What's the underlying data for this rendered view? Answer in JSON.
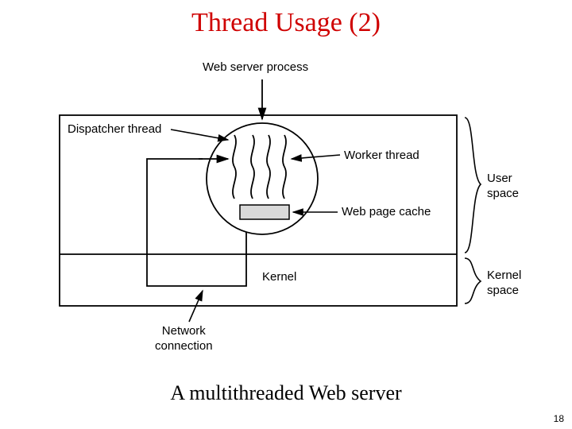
{
  "title": "Thread Usage (2)",
  "caption": "A multithreaded Web server",
  "page_number": "18",
  "labels": {
    "web_server_process": "Web server process",
    "dispatcher_thread": "Dispatcher thread",
    "worker_thread": "Worker thread",
    "web_page_cache": "Web page cache",
    "user_space": "User\nspace",
    "kernel_space": "Kernel\nspace",
    "kernel": "Kernel",
    "network_connection": "Network\nconnection"
  }
}
